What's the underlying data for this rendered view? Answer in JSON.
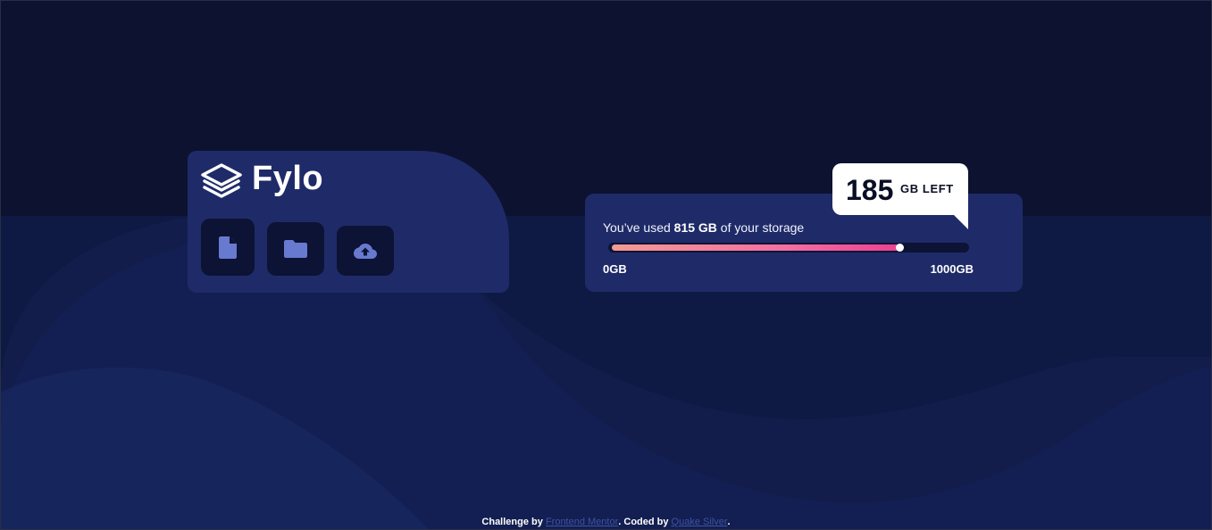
{
  "colors": {
    "background": "#0c1230",
    "card": "#1f2b68",
    "icon_button": "#0c1334",
    "icon_fill": "#6879d0",
    "gradient_start": "#f49a93",
    "gradient_end": "#ee3f92",
    "link": "#3e52a3"
  },
  "logo": {
    "icon": "layers-icon",
    "text": "Fylo"
  },
  "actions": [
    {
      "name": "document",
      "icon": "document-icon"
    },
    {
      "name": "folder",
      "icon": "folder-icon"
    },
    {
      "name": "upload",
      "icon": "upload-cloud-icon"
    }
  ],
  "storage": {
    "usage_prefix": "You’ve used ",
    "usage_amount": "815 GB",
    "usage_suffix": " of your storage",
    "used_fraction": 0.815,
    "scale_min": "0GB",
    "scale_max": "1000GB"
  },
  "tooltip": {
    "remaining_number": "185",
    "remaining_label": "GB LEFT"
  },
  "footer": {
    "prefix": "Challenge by ",
    "link1": "Frontend Mentor",
    "middle": ". Coded by ",
    "link2": "Quake Silver",
    "suffix": "."
  }
}
